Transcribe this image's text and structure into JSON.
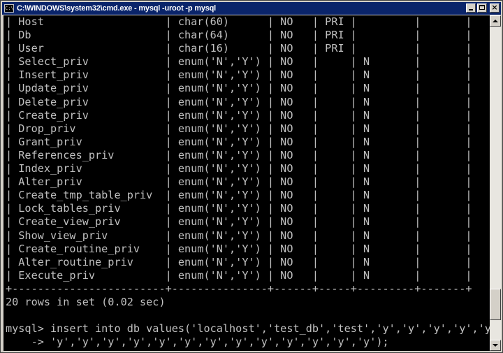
{
  "window": {
    "title": "C:\\WINDOWS\\system32\\cmd.exe - mysql -uroot -p mysql",
    "icon": "cmd-icon"
  },
  "scrollbar": {
    "position_fraction": 0.93,
    "visible_fraction": 0.1
  },
  "terminal": {
    "lines": [
      "| Host                   | char(60)      | NO   | PRI |         |       |",
      "| Db                     | char(64)      | NO   | PRI |         |       |",
      "| User                   | char(16)      | NO   | PRI |         |       |",
      "| Select_priv            | enum('N','Y') | NO   |     | N       |       |",
      "| Insert_priv            | enum('N','Y') | NO   |     | N       |       |",
      "| Update_priv            | enum('N','Y') | NO   |     | N       |       |",
      "| Delete_priv            | enum('N','Y') | NO   |     | N       |       |",
      "| Create_priv            | enum('N','Y') | NO   |     | N       |       |",
      "| Drop_priv              | enum('N','Y') | NO   |     | N       |       |",
      "| Grant_priv             | enum('N','Y') | NO   |     | N       |       |",
      "| References_priv        | enum('N','Y') | NO   |     | N       |       |",
      "| Index_priv             | enum('N','Y') | NO   |     | N       |       |",
      "| Alter_priv             | enum('N','Y') | NO   |     | N       |       |",
      "| Create_tmp_table_priv  | enum('N','Y') | NO   |     | N       |       |",
      "| Lock_tables_priv       | enum('N','Y') | NO   |     | N       |       |",
      "| Create_view_priv       | enum('N','Y') | NO   |     | N       |       |",
      "| Show_view_priv         | enum('N','Y') | NO   |     | N       |       |",
      "| Create_routine_priv    | enum('N','Y') | NO   |     | N       |       |",
      "| Alter_routine_priv     | enum('N','Y') | NO   |     | N       |       |",
      "| Execute_priv           | enum('N','Y') | NO   |     | N       |       |",
      "+------------------------+---------------+------+-----+---------+-------+",
      "20 rows in set (0.02 sec)",
      "",
      "mysql> insert into db values('localhost','test_db','test','y','y','y','y','y',",
      "    -> 'y','y','y','y','y','y','y','y','y','y','y','y','y');"
    ]
  }
}
